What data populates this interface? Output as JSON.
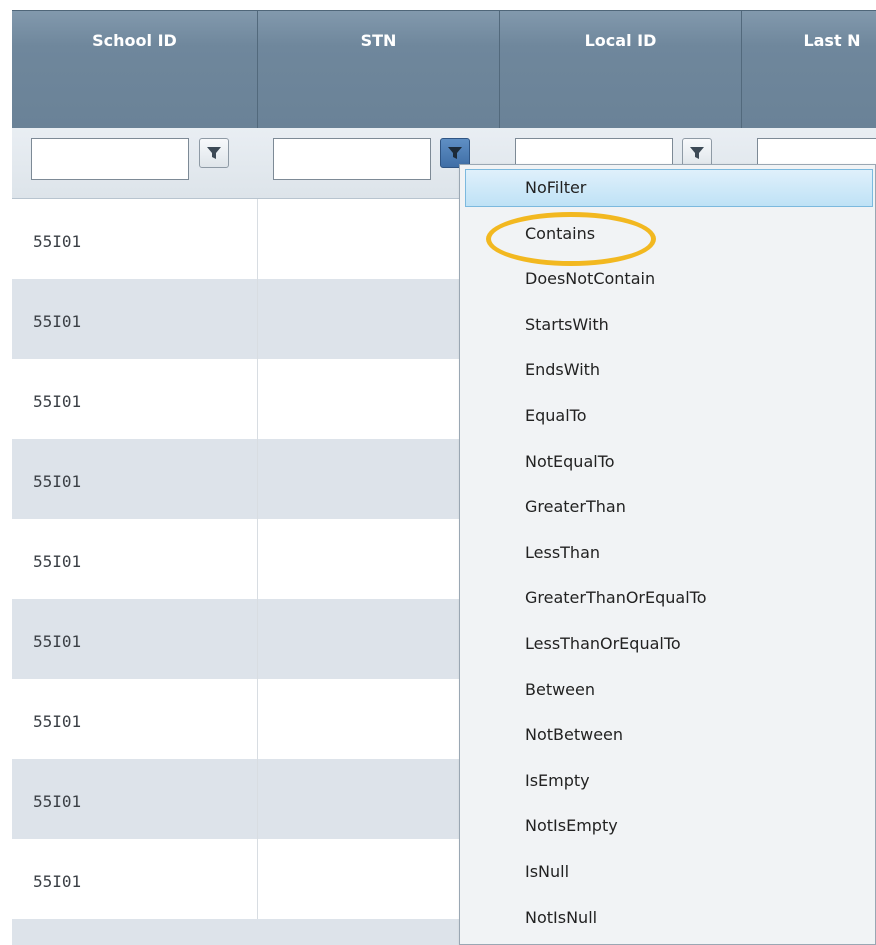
{
  "grid": {
    "columns": [
      {
        "label": "School ID"
      },
      {
        "label": "STN"
      },
      {
        "label": "Local ID"
      },
      {
        "label": "Last N"
      }
    ],
    "rows": [
      {
        "school_id": "55I01"
      },
      {
        "school_id": "55I01"
      },
      {
        "school_id": "55I01"
      },
      {
        "school_id": "55I01"
      },
      {
        "school_id": "55I01"
      },
      {
        "school_id": "55I01"
      },
      {
        "school_id": "55I01"
      },
      {
        "school_id": "55I01"
      },
      {
        "school_id": "55I01"
      }
    ]
  },
  "filter_menu": {
    "hovered": "NoFilter",
    "circled": "Contains",
    "options": [
      "NoFilter",
      "Contains",
      "DoesNotContain",
      "StartsWith",
      "EndsWith",
      "EqualTo",
      "NotEqualTo",
      "GreaterThan",
      "LessThan",
      "GreaterThanOrEqualTo",
      "LessThanOrEqualTo",
      "Between",
      "NotBetween",
      "IsEmpty",
      "NotIsEmpty",
      "IsNull",
      "NotIsNull"
    ]
  },
  "colors": {
    "header": "#6f879c",
    "row_alt": "#dde3ea",
    "highlight_ring": "#f2b820",
    "active_filter_button": "#3f6ea6"
  },
  "icons": {
    "filter": "filter-funnel-icon"
  }
}
